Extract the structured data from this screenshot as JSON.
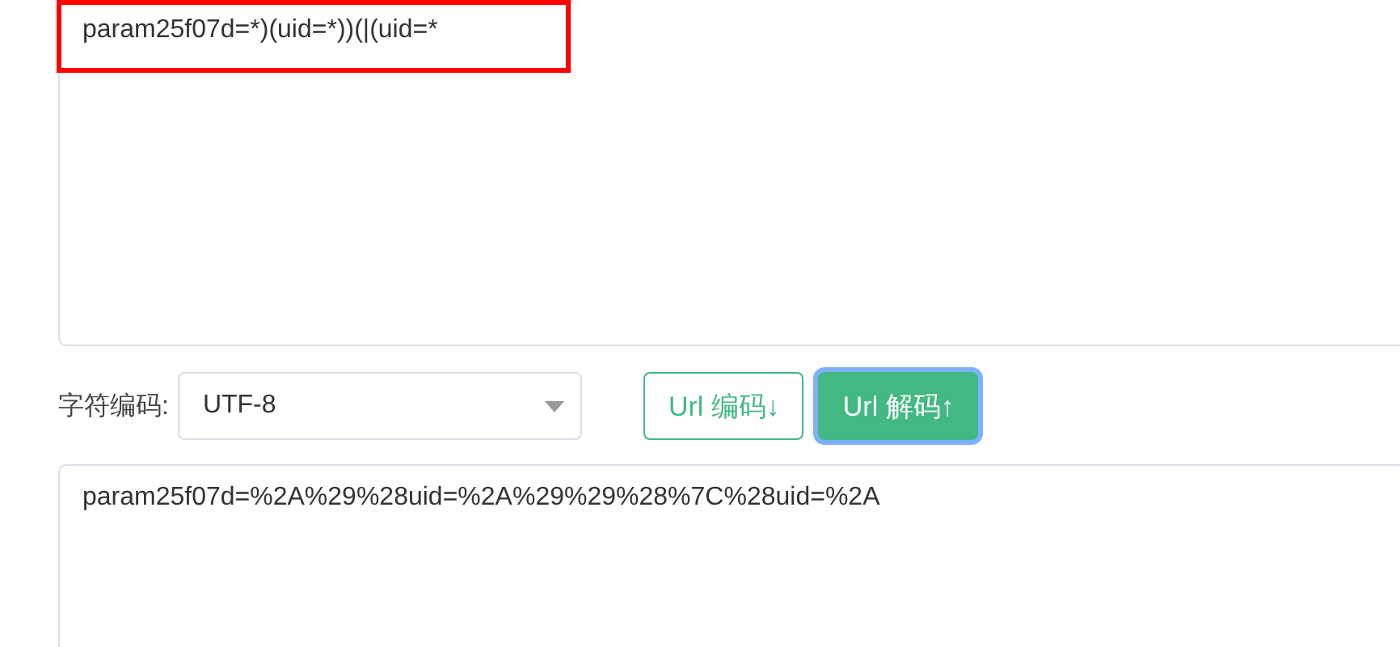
{
  "input_box": {
    "value": "param25f07d=*)(uid=*))(|(uid=*",
    "highlighted": true
  },
  "charset": {
    "label": "字符编码:",
    "value": "UTF-8"
  },
  "buttons": [
    {
      "label": "Url 编码↓",
      "selected": false
    },
    {
      "label": "Url 解码↑",
      "selected": true
    }
  ],
  "output_box": {
    "value": "param25f07d=%2A%29%28uid=%2A%29%29%28%7C%28uid=%2A"
  }
}
